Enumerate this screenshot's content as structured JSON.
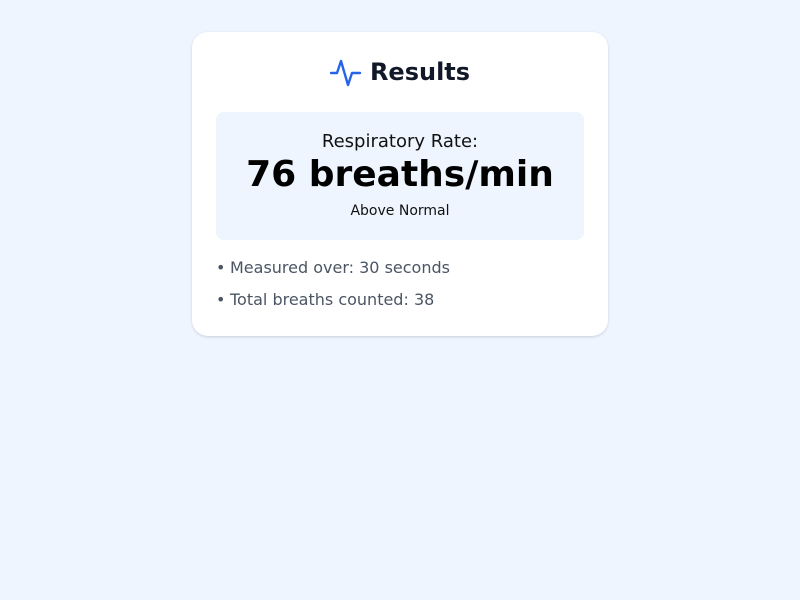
{
  "header": {
    "icon": "activity-pulse-icon",
    "title": "Results"
  },
  "result": {
    "label": "Respiratory Rate:",
    "value": "76 breaths/min",
    "status": "Above Normal"
  },
  "details": [
    {
      "bullet": "•",
      "text": "Measured over: 30 seconds"
    },
    {
      "bullet": "•",
      "text": "Total breaths counted: 38"
    }
  ],
  "colors": {
    "background": "#eef5fe",
    "card": "#ffffff",
    "accent": "#2563eb",
    "title": "#111827",
    "detail_text": "#4b5563"
  }
}
